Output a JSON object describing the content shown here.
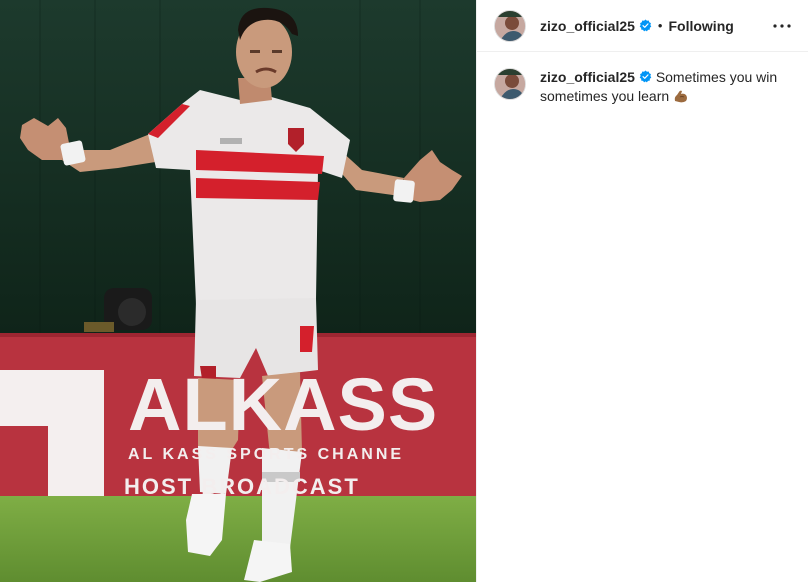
{
  "post": {
    "author": {
      "username": "zizo_official25",
      "verified": true
    },
    "follow_status": "Following",
    "separator": "•",
    "more_icon": "more-horizontal-icon",
    "caption": {
      "username": "zizo_official25",
      "line1": "Sometimes you win",
      "line2": "sometimes you learn",
      "emoji": "flexed-biceps-icon"
    }
  },
  "photo": {
    "billboard_big": "ALKASS",
    "billboard_sub": "AL KASS SPORTS CHANNE",
    "billboard_sub2": "HOST BROADCAST",
    "colors": {
      "background_dark": "#143024",
      "billboard_red": "#b8333f",
      "pitch_green": "#6f9e3a",
      "jersey_white": "#ebe9e9",
      "stripe_red": "#d4202c"
    }
  },
  "colors": {
    "verified_blue": "#0095f6",
    "text": "#262626",
    "divider": "#efefef"
  }
}
